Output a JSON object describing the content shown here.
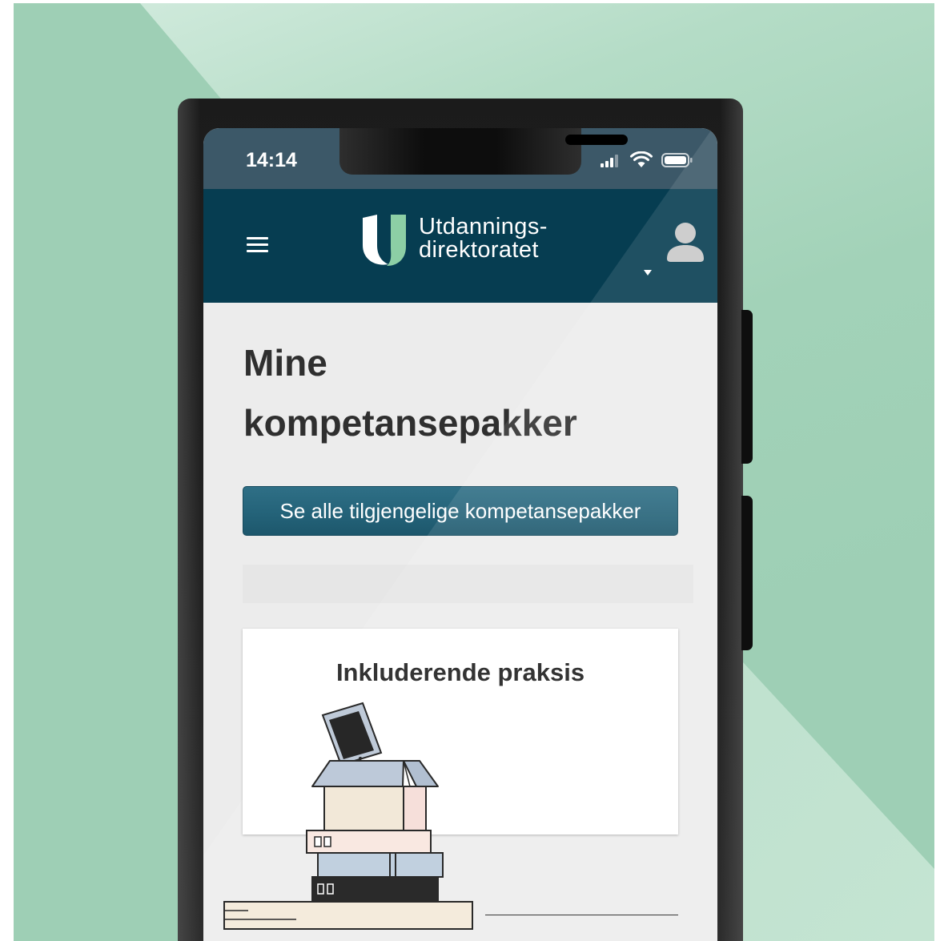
{
  "status_bar": {
    "time": "14:14",
    "icons": [
      "cellular-signal-icon",
      "wifi-icon",
      "battery-icon"
    ]
  },
  "header": {
    "menu_icon": "hamburger-menu-icon",
    "logo_line1": "Utdannings-",
    "logo_line2": "direktoratet",
    "avatar_icon": "user-avatar-icon",
    "dropdown_icon": "caret-down-icon"
  },
  "page": {
    "title": "Mine kompetansepakker",
    "all_packages_button": "Se alle tilgjengelige kompetansepakker"
  },
  "cards": [
    {
      "title": "Inkluderende praksis",
      "illustration": "books-and-box-illustration"
    }
  ],
  "colors": {
    "bg_green": "#9ecfb5",
    "status_bar": "#3c5868",
    "header": "#063d51",
    "button": "#246379",
    "content_bg": "#ececec",
    "logo_green": "#8ccfa5"
  }
}
